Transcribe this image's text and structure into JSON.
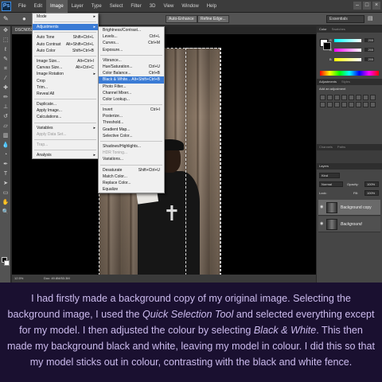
{
  "menubar": {
    "app_logo": "Ps",
    "items": [
      "File",
      "Edit",
      "Image",
      "Layer",
      "Type",
      "Select",
      "Filter",
      "3D",
      "View",
      "Window",
      "Help"
    ]
  },
  "optbar": {
    "refine_label": "Auto-Enhance",
    "refine_edge": "Refine Edge...",
    "workspace": "Essentials"
  },
  "document": {
    "tab_title": "DSCN053...",
    "zoom": "12.5%",
    "doc_size": "Doc: 49.8M/53.3M"
  },
  "image_menu": {
    "items": [
      {
        "label": "Mode",
        "shortcut": "",
        "submenu": true
      },
      {
        "sep": true
      },
      {
        "label": "Adjustments",
        "shortcut": "",
        "submenu": true,
        "highlight": true
      },
      {
        "sep": true
      },
      {
        "label": "Auto Tone",
        "shortcut": "Shift+Ctrl+L"
      },
      {
        "label": "Auto Contrast",
        "shortcut": "Alt+Shift+Ctrl+L"
      },
      {
        "label": "Auto Color",
        "shortcut": "Shift+Ctrl+B"
      },
      {
        "sep": true
      },
      {
        "label": "Image Size...",
        "shortcut": "Alt+Ctrl+I"
      },
      {
        "label": "Canvas Size...",
        "shortcut": "Alt+Ctrl+C"
      },
      {
        "label": "Image Rotation",
        "shortcut": "",
        "submenu": true
      },
      {
        "label": "Crop",
        "shortcut": ""
      },
      {
        "label": "Trim...",
        "shortcut": ""
      },
      {
        "label": "Reveal All",
        "shortcut": ""
      },
      {
        "sep": true
      },
      {
        "label": "Duplicate...",
        "shortcut": ""
      },
      {
        "label": "Apply Image...",
        "shortcut": ""
      },
      {
        "label": "Calculations...",
        "shortcut": ""
      },
      {
        "sep": true
      },
      {
        "label": "Variables",
        "shortcut": "",
        "submenu": true
      },
      {
        "label": "Apply Data Set...",
        "shortcut": "",
        "disabled": true
      },
      {
        "sep": true
      },
      {
        "label": "Trap...",
        "shortcut": "",
        "disabled": true
      },
      {
        "sep": true
      },
      {
        "label": "Analysis",
        "shortcut": "",
        "submenu": true
      }
    ]
  },
  "adjustments_menu": {
    "items": [
      {
        "label": "Brightness/Contrast...",
        "shortcut": ""
      },
      {
        "label": "Levels...",
        "shortcut": "Ctrl+L"
      },
      {
        "label": "Curves...",
        "shortcut": "Ctrl+M"
      },
      {
        "label": "Exposure...",
        "shortcut": ""
      },
      {
        "sep": true
      },
      {
        "label": "Vibrance...",
        "shortcut": ""
      },
      {
        "label": "Hue/Saturation...",
        "shortcut": "Ctrl+U"
      },
      {
        "label": "Color Balance...",
        "shortcut": "Ctrl+B"
      },
      {
        "label": "Black & White...",
        "shortcut": "Alt+Shift+Ctrl+B",
        "highlight": true
      },
      {
        "label": "Photo Filter...",
        "shortcut": ""
      },
      {
        "label": "Channel Mixer...",
        "shortcut": ""
      },
      {
        "label": "Color Lookup...",
        "shortcut": ""
      },
      {
        "sep": true
      },
      {
        "label": "Invert",
        "shortcut": "Ctrl+I"
      },
      {
        "label": "Posterize...",
        "shortcut": ""
      },
      {
        "label": "Threshold...",
        "shortcut": ""
      },
      {
        "label": "Gradient Map...",
        "shortcut": ""
      },
      {
        "label": "Selective Color...",
        "shortcut": ""
      },
      {
        "sep": true
      },
      {
        "label": "Shadows/Highlights...",
        "shortcut": ""
      },
      {
        "label": "HDR Toning...",
        "shortcut": "",
        "disabled": true
      },
      {
        "label": "Variations...",
        "shortcut": ""
      },
      {
        "sep": true
      },
      {
        "label": "Desaturate",
        "shortcut": "Shift+Ctrl+U"
      },
      {
        "label": "Match Color...",
        "shortcut": ""
      },
      {
        "label": "Replace Color...",
        "shortcut": ""
      },
      {
        "label": "Equalize",
        "shortcut": ""
      }
    ]
  },
  "panels": {
    "color_tab": "Color",
    "swatches_tab": "Swatches",
    "sliders": [
      {
        "label": "R",
        "value": "255",
        "gradient": "linear-gradient(90deg,#0ff,#fff)"
      },
      {
        "label": "G",
        "value": "255",
        "gradient": "linear-gradient(90deg,#f0f,#fff)"
      },
      {
        "label": "B",
        "value": "255",
        "gradient": "linear-gradient(90deg,#ff0,#fff)"
      }
    ],
    "adjustments_tab": "Adjustments",
    "styles_tab": "Styles",
    "add_adjustment": "Add an adjustment",
    "channels_tab": "Channels",
    "paths_tab": "Paths",
    "layers_tab": "Layers",
    "kind": "Kind",
    "blend_mode": "Normal",
    "opacity_label": "Opacity:",
    "opacity_value": "100%",
    "lock_label": "Lock:",
    "fill_label": "Fill:",
    "fill_value": "100%",
    "layers": [
      {
        "name": "Background copy",
        "selected": true,
        "italic": false
      },
      {
        "name": "Background",
        "selected": false,
        "italic": true
      }
    ]
  },
  "caption": {
    "part1": "I had firstly made a background copy of my original image. Selecting the background image, I used the ",
    "tool": "Quick Selection Tool",
    "part2": " and selected everything except for my model. I then adjusted the colour by selecting ",
    "adjustment": "Black & White",
    "part3": ". This then made my background black and white, leaving my model in colour. I did this so that my model sticks out in colour, contrasting with the black and white fence."
  }
}
